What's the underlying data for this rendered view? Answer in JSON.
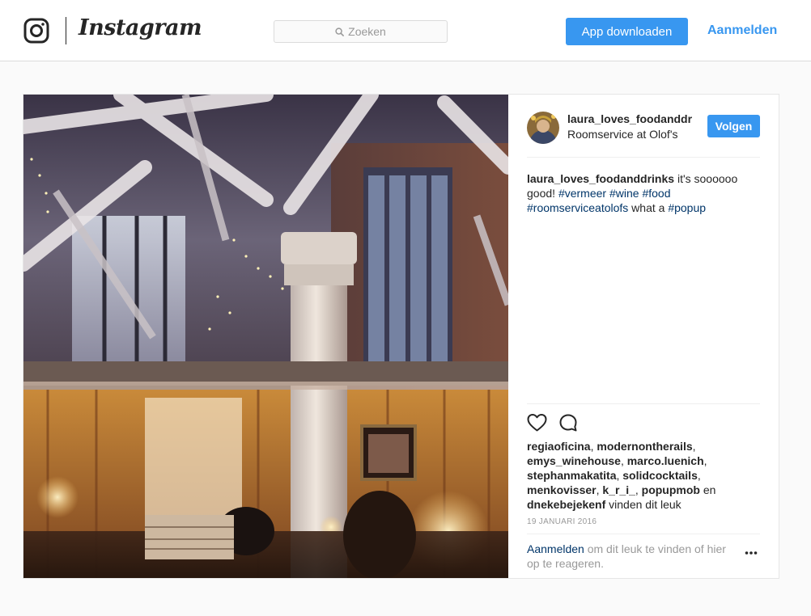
{
  "header": {
    "brand": "Instagram",
    "search_placeholder": "Zoeken",
    "download_label": "App downloaden",
    "login_label": "Aanmelden"
  },
  "post": {
    "username": "laura_loves_foodanddr",
    "location": "Roomservice at Olof's",
    "follow_label": "Volgen",
    "caption_user": "laura_loves_foodanddrinks",
    "caption": {
      "t1": "it's soooooo good!",
      "h1": "#vermeer",
      "h2": "#wine",
      "h3": "#food",
      "h4": "#roomserviceatolofs",
      "t2": "what a",
      "h5": "#popup"
    },
    "likes": {
      "users": [
        "regiaoficina",
        "modernontherails",
        "emys_winehouse",
        "marco.luenich",
        "stephanmakatita",
        "solidcocktails",
        "menkovisser",
        "k_r_i_",
        "popupmob",
        "dnekebejekenf"
      ],
      "and_word": "en",
      "suffix": "vinden dit leuk"
    },
    "date": "19 JANUARI 2016",
    "comment_prompt": {
      "link": "Aanmelden",
      "text": "om dit leuk te vinden of hier op te reageren."
    }
  },
  "colors": {
    "accent": "#3897f0",
    "hashtag": "#003569",
    "muted": "#999999",
    "border": "#dbdbdb"
  },
  "icons": {
    "logo": "instagram-camera-icon",
    "search": "search-icon",
    "like": "heart-icon",
    "comment": "comment-bubble-icon",
    "more": "more-options-icon"
  }
}
